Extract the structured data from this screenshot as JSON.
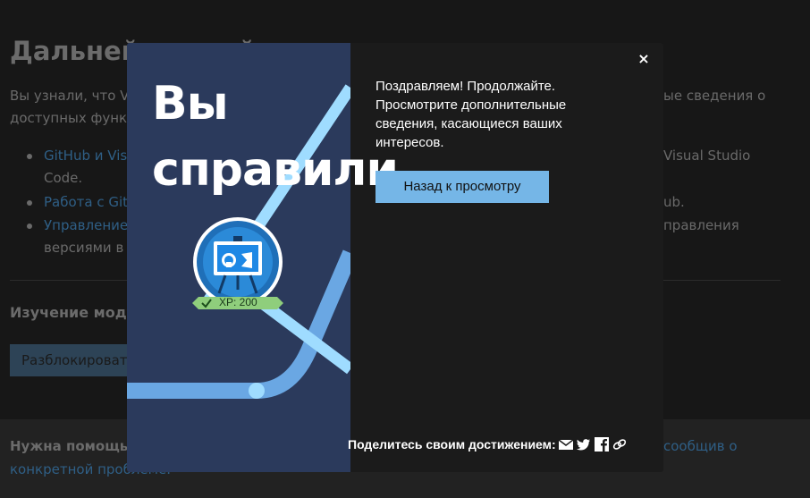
{
  "background": {
    "heading": "Дальней",
    "heading_tail": "й",
    "intro_left": "Вы узнали, что Vis",
    "intro_right": "ые сведения о",
    "intro_line2": "доступных функци",
    "list": [
      {
        "link": "GitHub и Visu",
        "right": "Visual Studio",
        "line2": "Code."
      },
      {
        "link": "Работа с GitH",
        "right": "ub."
      },
      {
        "link": "Управление",
        "right": "правления",
        "line2": "версиями в V"
      }
    ],
    "module_title": "Изучение моду",
    "unlock_button": "Разблокироват",
    "footer_help": "Нужна помощь? С",
    "footer_link_right": "сообщив о",
    "footer_link_line2": "конкретной проблеме."
  },
  "modal": {
    "art_title_line1": "Вы",
    "art_title_line2": "справили",
    "badge_xp": "XP: 200",
    "message": "Поздравляем! Продолжайте. Просмотрите дополнительные сведения, касающиеся ваших интересов.",
    "back_button": "Назад к просмотру",
    "close_label": "×",
    "share_label": "Поделитесь своим достижением:",
    "share_icons": [
      "email-icon",
      "twitter-icon",
      "facebook-icon",
      "link-icon"
    ]
  },
  "colors": {
    "art_bg": "#2b3a5c",
    "line_light": "#9fdcff",
    "line_mid": "#6aa7e3",
    "button_bg": "#75b6e7",
    "badge_green": "#8fce7c",
    "link": "#2f5f86"
  }
}
